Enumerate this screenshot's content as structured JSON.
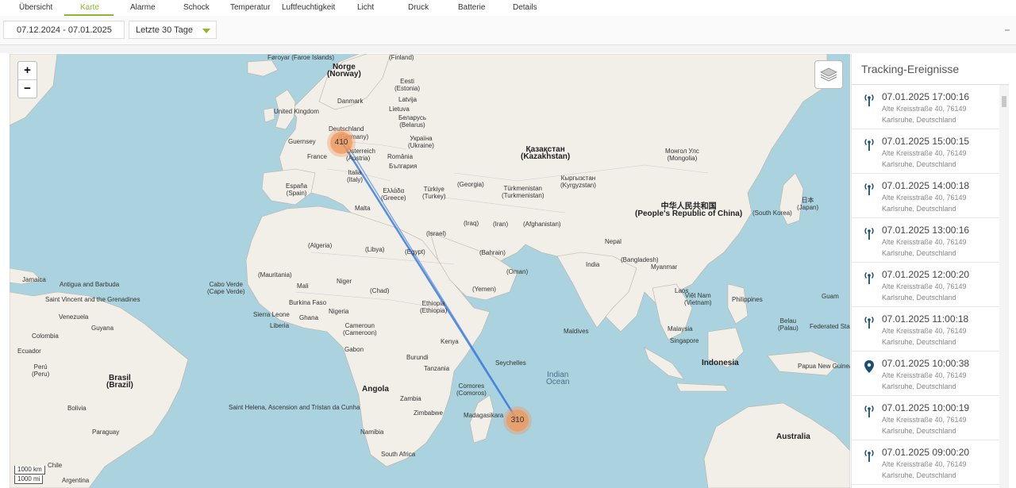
{
  "tabs": [
    "Übersicht",
    "Karte",
    "Alarme",
    "Schock",
    "Temperatur",
    "Luftfeuchtigkeit",
    "Licht",
    "Druck",
    "Batterie",
    "Details"
  ],
  "active_tab": "Karte",
  "filter": {
    "date_range": "07.12.2024 - 07.01.2025",
    "period": "Letzte 30 Tage"
  },
  "map": {
    "zoom_in": "+",
    "zoom_out": "−",
    "clusters": {
      "europe": "410",
      "mauritius": "310"
    },
    "scale_km": "1000 km",
    "scale_mi": "1000 mi",
    "labels": {
      "faroe": "Føroyar\n(Faroe Islands)",
      "norway": "Norge\n(Norway)",
      "finland": "(Finland)",
      "eesti": "Eesti\n(Estonia)",
      "uk": "United Kingdom",
      "danmark": "Danmark",
      "latvija": "Latvija",
      "lietuva": "Lietuva",
      "belarus": "Беларусь\n(Belarus)",
      "deutschland": "Deutschland",
      "germany": "(Germany)",
      "guernsey": "Guernsey",
      "ukraine": "Україна\n(Ukraine)",
      "france": "France",
      "osterreich": "Österreich",
      "austria": "(Austria)",
      "romania": "România",
      "bulgaria": "България",
      "kazakhstan": "Қазақстан\n(Kazakhstan)",
      "mongolia": "Монгол Улс\n(Mongolia)",
      "italia": "Italia\n(Italy)",
      "espana": "España\n(Spain)",
      "ellada": "Ελλάδα\n(Greece)",
      "turkiye": "Türkiye\n(Turkey)",
      "georgia": "(Georgia)",
      "turkmenistan": "Türkmenistan\n(Turkmenistan)",
      "kyrgyzstan": "Кыргызстан\n(Kyrgyzstan)",
      "china": "中华人民共和国\n(People's Republic of China)",
      "japan": "日本\n(Japan)",
      "south_korea": "(South Korea)",
      "malta": "Malta",
      "iraq": "(Iraq)",
      "iran": "(Iran)",
      "afghanistan": "(Afghanistan)",
      "israel": "(Israel)",
      "algeria": "(Algeria)",
      "libya": "(Libya)",
      "egypt": "(Egypt)",
      "bahrain": "(Bahrain)",
      "nepal": "Nepal",
      "bangladesh": "(Bangladesh)",
      "india": "India",
      "oman": "(Oman)",
      "yemen": "(Yemen)",
      "mauritania": "(Mauritania)",
      "mali": "Mali",
      "niger": "Niger",
      "chad": "(Chad)",
      "ethiopia": "Ethiopia\n(Ethiopia)",
      "burkina": "Burkina Faso",
      "nigeria": "Nigeria",
      "sierra_leone": "Sierra Leone",
      "liberia": "Liberia",
      "ghana": "Ghana",
      "cameroon": "Cameroun\n(Cameroon)",
      "gabon": "Gabon",
      "kenya": "Kenya",
      "burundi": "Burundi",
      "tanzania": "Tanzania",
      "seychelles": "Seychelles",
      "maldives": "Maldives",
      "angola": "Angola",
      "zambia": "Zambia",
      "zimbabwe": "Zimbabwe",
      "comoros": "Comores\n(Comoros)",
      "madagascar": "Madagasikara",
      "namibia": "Namibia",
      "south_africa": "South Africa",
      "saint_helena": "Saint Helena, Ascension and Tristan da Cunha",
      "cabo_verde": "Cabo Verde\n(Cape Verde)",
      "jamaica": "Jamaica",
      "antigua": "Antigua and Barbuda",
      "st_vincent": "Saint Vincent and the Grenadines",
      "venezuela": "Venezuela",
      "guyana": "Guyana",
      "colombia": "Colombia",
      "ecuador": "Ecuador",
      "peru": "Perú\n(Peru)",
      "brasil": "Brasil\n(Brazil)",
      "bolivia": "Bolivia",
      "paraguay": "Paraguay",
      "chile": "Chile",
      "argentina": "Argentina",
      "myanmar": "Myanmar",
      "laos": "Laos",
      "vietnam": "Việt Nam\n(Vietnam)",
      "philippines": "Philippines",
      "guam": "Guam",
      "malaysia": "Malaysia",
      "singapore": "Singapore",
      "palau": "Belau\n(Palau)",
      "micronesia": "Federated States",
      "indonesia": "Indonesia",
      "png": "Papua New Guinea",
      "australia": "Australia",
      "indian_ocean": "Indian\nOcean"
    }
  },
  "panel": {
    "title": "Tracking-Ereignisse",
    "events": [
      {
        "time": "07.01.2025 17:00:16",
        "address": "Alte Kreisstraße 40, 76149 Karlsruhe, Deutschland",
        "icon": "antenna-icon"
      },
      {
        "time": "07.01.2025 15:00:15",
        "address": "Alte Kreisstraße 40, 76149 Karlsruhe, Deutschland",
        "icon": "antenna-icon"
      },
      {
        "time": "07.01.2025 14:00:18",
        "address": "Alte Kreisstraße 40, 76149 Karlsruhe, Deutschland",
        "icon": "antenna-icon"
      },
      {
        "time": "07.01.2025 13:00:16",
        "address": "Alte Kreisstraße 40, 76149 Karlsruhe, Deutschland",
        "icon": "antenna-icon"
      },
      {
        "time": "07.01.2025 12:00:20",
        "address": "Alte Kreisstraße 40, 76149 Karlsruhe, Deutschland",
        "icon": "antenna-icon"
      },
      {
        "time": "07.01.2025 11:00:18",
        "address": "Alte Kreisstraße 40, 76149 Karlsruhe, Deutschland",
        "icon": "antenna-icon"
      },
      {
        "time": "07.01.2025 10:00:38",
        "address": "Alte Kreisstraße 40, 76149 Karlsruhe, Deutschland",
        "icon": "map-pin-icon"
      },
      {
        "time": "07.01.2025 10:00:19",
        "address": "Alte Kreisstraße 40, 76149 Karlsruhe, Deutschland",
        "icon": "antenna-icon"
      },
      {
        "time": "07.01.2025 09:00:20",
        "address": "Alte Kreisstraße 40, 76149 Karlsruhe, Deutschland",
        "icon": "antenna-icon"
      }
    ]
  },
  "colors": {
    "accent": "#8bb82e",
    "water": "#aad3df",
    "land": "#f2efe9",
    "route": "#3b7ddd",
    "cluster": "#f0965a"
  }
}
